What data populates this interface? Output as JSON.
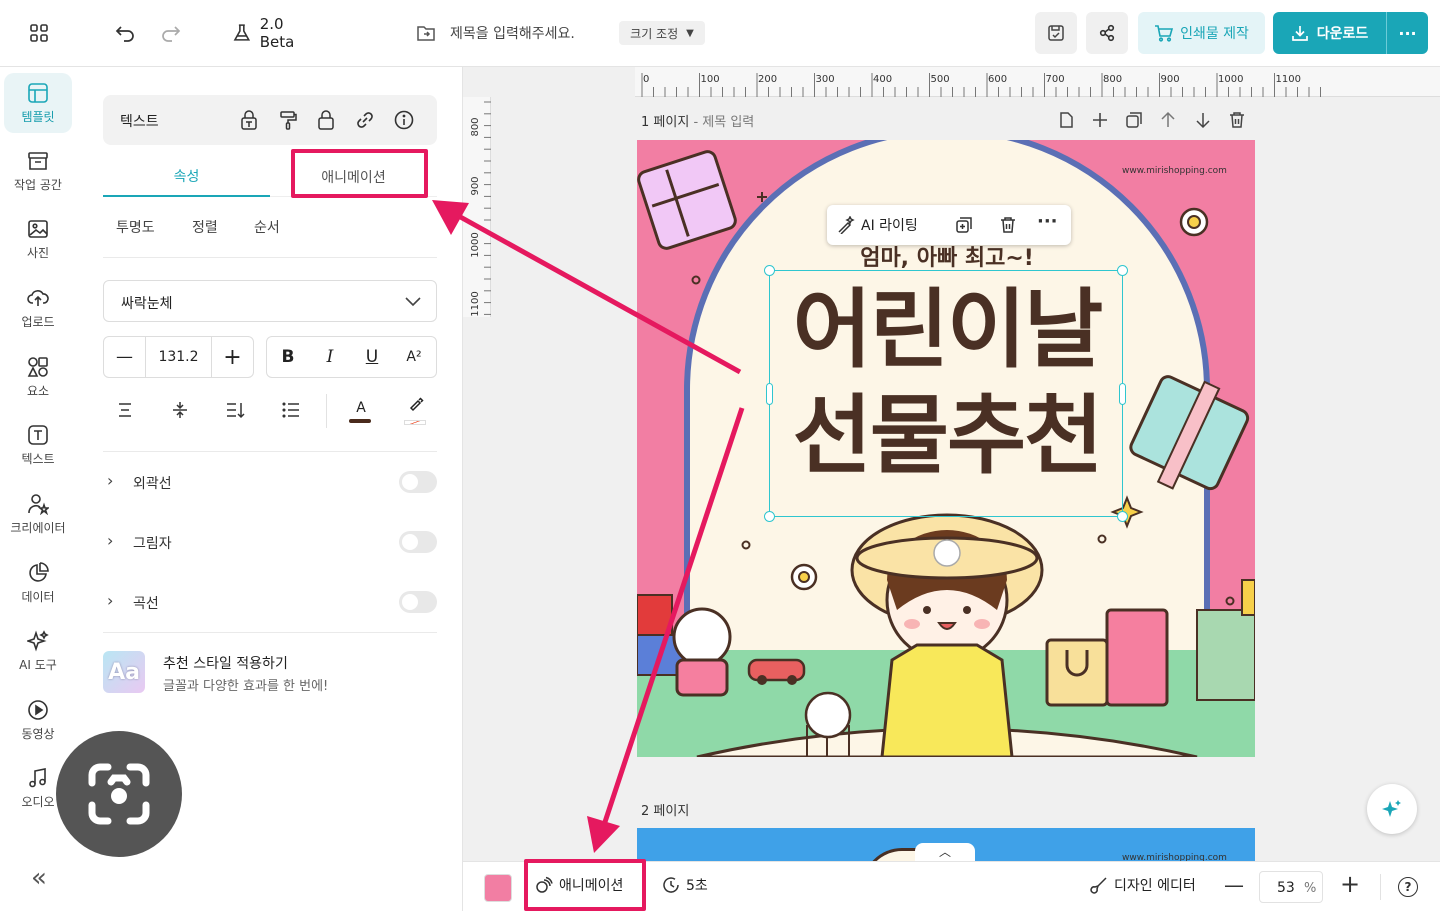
{
  "topbar": {
    "version": "2.0 Beta",
    "title_placeholder": "제목을 입력해주세요.",
    "resize": "크기 조정",
    "print_button": "인쇄물 제작",
    "download_button": "다운로드",
    "more": "···"
  },
  "sidebar": {
    "items": [
      {
        "label": "템플릿",
        "icon": "template-icon"
      },
      {
        "label": "작업 공간",
        "icon": "workspace-icon"
      },
      {
        "label": "사진",
        "icon": "photo-icon"
      },
      {
        "label": "업로드",
        "icon": "upload-icon"
      },
      {
        "label": "요소",
        "icon": "elements-icon"
      },
      {
        "label": "텍스트",
        "icon": "text-icon"
      },
      {
        "label": "크리에이터",
        "icon": "creator-icon"
      },
      {
        "label": "데이터",
        "icon": "data-icon"
      },
      {
        "label": "AI 도구",
        "icon": "ai-tools-icon"
      },
      {
        "label": "동영상",
        "icon": "video-icon"
      },
      {
        "label": "오디오",
        "icon": "audio-icon"
      }
    ],
    "collapse": "«"
  },
  "panel": {
    "header": "텍스트",
    "tabs": [
      "속성",
      "애니메이션"
    ],
    "subtabs": [
      "투명도",
      "정렬",
      "순서"
    ],
    "font": "싸락눈체",
    "font_size": "131.2",
    "styles": [
      "B",
      "I",
      "U",
      "A²"
    ],
    "color_label": "A",
    "options": [
      {
        "label": "외곽선"
      },
      {
        "label": "그림자"
      },
      {
        "label": "곡선"
      }
    ],
    "promo_title": "추천 스타일 적용하기",
    "promo_desc": "글꼴과 다양한 효과를 한 번에!",
    "promo_icon": "Aa"
  },
  "ruler": {
    "h": [
      "0",
      "100",
      "200",
      "300",
      "400",
      "500",
      "600",
      "700",
      "800",
      "900",
      "1000",
      "1100"
    ],
    "v": [
      "800",
      "900",
      "1000",
      "1100"
    ]
  },
  "canvas": {
    "page1_label": "1 페이지",
    "page1_title": "- 제목 입력",
    "page2_label": "2 페이지",
    "ai_writing": "AI 라이팅",
    "design": {
      "url": "www.mirishopping.com",
      "subtitle": "엄마, 아빠 최고~!",
      "title_line1": "어린이날",
      "title_line2": "선물추천"
    }
  },
  "bottombar": {
    "animation": "애니메이션",
    "duration": "5초",
    "design_editor": "디자인 에디터",
    "zoom": "53",
    "zoom_unit": "%",
    "help": "?"
  },
  "colors": {
    "accent": "#1aa6b7",
    "highlight": "#e5195f",
    "page_bg": "#f27ea3"
  }
}
